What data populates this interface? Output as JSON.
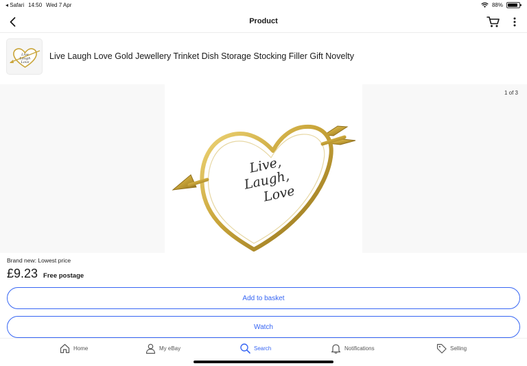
{
  "status": {
    "carrier": "◂ Safari",
    "time": "14:50",
    "date": "Wed 7 Apr",
    "battery": "88%",
    "battery_level": 0.88
  },
  "nav": {
    "title": "Product",
    "back_icon": "chevron-left-icon",
    "cart_icon": "cart-icon",
    "more_icon": "more-vertical-icon"
  },
  "product": {
    "title": "Live Laugh Love Gold Jewellery Trinket Dish Storage Stocking Filler Gift Novelty",
    "image_counter": "1 of 3",
    "image_text": [
      "Live,",
      "Laugh,",
      "Love"
    ],
    "thumb_text": [
      "Live",
      "Laugh",
      "Love"
    ],
    "condition": "Brand new: Lowest price",
    "price": "£9.23",
    "postage": "Free postage"
  },
  "buttons": {
    "add_to_basket": "Add to basket",
    "watch": "Watch"
  },
  "tabs": [
    {
      "label": "Home",
      "icon": "home-icon"
    },
    {
      "label": "My eBay",
      "icon": "user-icon"
    },
    {
      "label": "Search",
      "icon": "search-icon"
    },
    {
      "label": "Notifications",
      "icon": "bell-icon"
    },
    {
      "label": "Selling",
      "icon": "tag-icon"
    }
  ],
  "colors": {
    "accent": "#3665f3",
    "gold": "#c9a53a",
    "text": "#191919"
  }
}
